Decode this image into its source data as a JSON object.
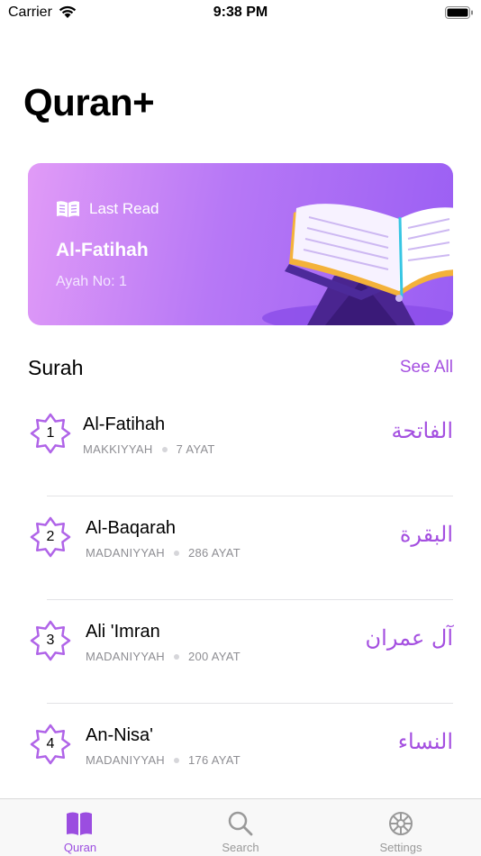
{
  "status_bar": {
    "carrier": "Carrier",
    "time": "9:38 PM"
  },
  "app": {
    "title": "Quran+"
  },
  "last_read": {
    "label": "Last Read",
    "surah": "Al-Fatihah",
    "ayah": "Ayah No: 1"
  },
  "surah_section": {
    "title": "Surah",
    "see_all": "See All"
  },
  "surahs": [
    {
      "number": "1",
      "name": "Al-Fatihah",
      "type": "MAKKIYYAH",
      "ayat": "7 AYAT",
      "arabic": "الفاتحة"
    },
    {
      "number": "2",
      "name": "Al-Baqarah",
      "type": "MADANIYYAH",
      "ayat": "286 AYAT",
      "arabic": "البقرة"
    },
    {
      "number": "3",
      "name": "Ali 'Imran",
      "type": "MADANIYYAH",
      "ayat": "200 AYAT",
      "arabic": "آل عمران"
    },
    {
      "number": "4",
      "name": "An-Nisa'",
      "type": "MADANIYYAH",
      "ayat": "176 AYAT",
      "arabic": "النساء"
    }
  ],
  "tabs": [
    {
      "label": "Quran",
      "icon": "book-icon",
      "active": true
    },
    {
      "label": "Search",
      "icon": "search-icon",
      "active": false
    },
    {
      "label": "Settings",
      "icon": "gear-icon",
      "active": false
    }
  ],
  "colors": {
    "accent": "#a44fe0",
    "card_start": "#e19bf7",
    "card_end": "#9a5ef3"
  }
}
